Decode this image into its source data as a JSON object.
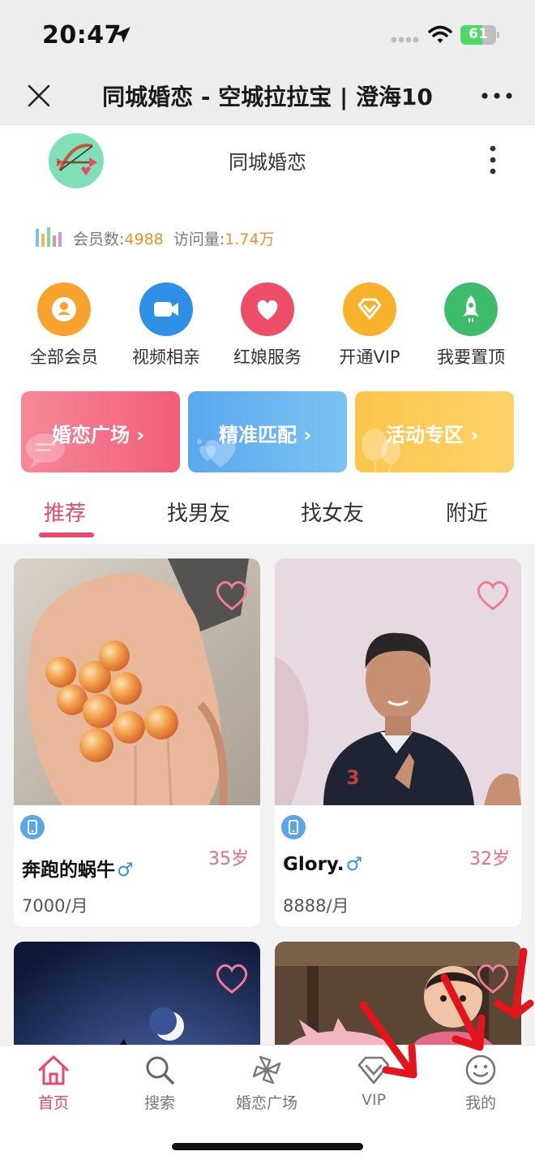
{
  "status_bar": {
    "time": "20:47",
    "battery": "61",
    "battery_level": 0.61
  },
  "title_bar": {
    "title": "同城婚恋 - 空城拉拉宝 | 澄海10"
  },
  "site": {
    "name": "同城婚恋"
  },
  "stats": {
    "members_label": "会员数:",
    "members_value": "4988",
    "visits_label": "访问量:",
    "visits_value": "1.74万"
  },
  "quick_links": [
    {
      "label": "全部会员",
      "icon": "member-icon",
      "color": "#f7a32d"
    },
    {
      "label": "视频相亲",
      "icon": "video-icon",
      "color": "#2f8fe6"
    },
    {
      "label": "红娘服务",
      "icon": "heart-icon",
      "color": "#ee4d67"
    },
    {
      "label": "开通VIP",
      "icon": "diamond-icon",
      "color": "#f8b12b"
    },
    {
      "label": "我要置顶",
      "icon": "rocket-icon",
      "color": "#3dbd6c"
    }
  ],
  "banners": [
    {
      "label": "婚恋广场 ›",
      "color": "#f26e84"
    },
    {
      "label": "精准匹配 ›",
      "color": "#63b3ee"
    },
    {
      "label": "活动专区 ›",
      "color": "#fcc64c"
    }
  ],
  "tabs": [
    "推荐",
    "找男友",
    "找女友",
    "附近"
  ],
  "cards": [
    {
      "name": "奔跑的蜗牛",
      "gender": "♂",
      "age": "35岁",
      "income": "7000/月"
    },
    {
      "name": "Glory.",
      "gender": "♂",
      "age": "32岁",
      "income": "8888/月"
    },
    {
      "name": "",
      "gender": "",
      "age": "",
      "income": ""
    },
    {
      "name": "",
      "gender": "",
      "age": "",
      "income": ""
    }
  ],
  "bottom_nav": [
    {
      "label": "首页",
      "icon": "home-icon"
    },
    {
      "label": "搜索",
      "icon": "search-icon"
    },
    {
      "label": "婚恋广场",
      "icon": "pinwheel-icon"
    },
    {
      "label": "VIP",
      "icon": "diamond-icon"
    },
    {
      "label": "我的",
      "icon": "smiley-icon"
    }
  ]
}
